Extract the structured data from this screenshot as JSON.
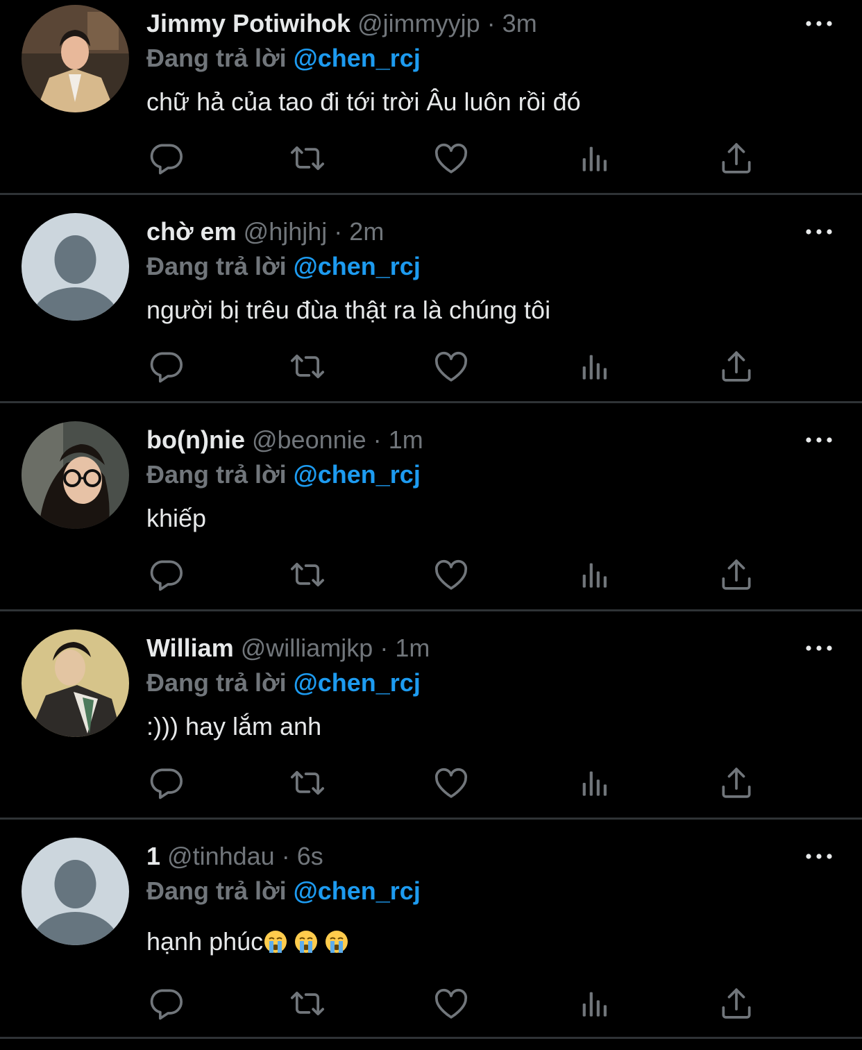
{
  "colors": {
    "background": "#000000",
    "text": "#e7e9ea",
    "muted": "#71767b",
    "accent": "#1d9bf0",
    "divider": "#2f3336"
  },
  "tweets": [
    {
      "name": "Jimmy Potiwihok",
      "handle": "@jimmyyjp",
      "sep": "·",
      "time": "3m",
      "reply_label": "Đang trả lời",
      "reply_to": "@chen_rcj",
      "text": "chữ hả của tao đi tới trời Âu luôn rồi đó",
      "avatar": "photo-suit"
    },
    {
      "name": "chờ em",
      "handle": "@hjhjhj",
      "sep": "·",
      "time": "2m",
      "reply_label": "Đang trả lời",
      "reply_to": "@chen_rcj",
      "text": "người bị trêu đùa thật ra là chúng tôi",
      "avatar": "default"
    },
    {
      "name": "bo(n)nie",
      "handle": "@beonnie",
      "sep": "·",
      "time": "1m",
      "reply_label": "Đang trả lời",
      "reply_to": "@chen_rcj",
      "text": "khiếp",
      "avatar": "photo-glasses"
    },
    {
      "name": "William",
      "handle": "@williamjkp",
      "sep": "·",
      "time": "1m",
      "reply_label": "Đang trả lời",
      "reply_to": "@chen_rcj",
      "text": ":))) hay lắm anh",
      "avatar": "photo-tie"
    },
    {
      "name": "1",
      "handle": "@tinhdau",
      "sep": "·",
      "time": "6s",
      "reply_label": "Đang trả lời",
      "reply_to": "@chen_rcj",
      "text": "hạnh phúc",
      "avatar": "default",
      "emojis": [
        "crying-face",
        "crying-face",
        "crying-face"
      ]
    }
  ],
  "icons": {
    "more": "more-horizontal-icon",
    "reply": "reply-icon",
    "retweet": "retweet-icon",
    "like": "heart-icon",
    "views": "views-icon",
    "share": "share-icon"
  }
}
